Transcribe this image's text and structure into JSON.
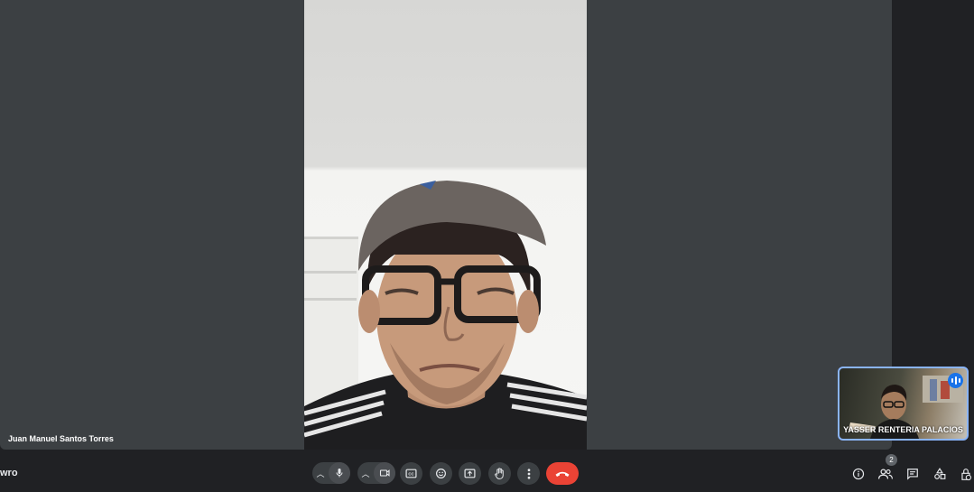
{
  "meeting": {
    "code_fragment": "wro"
  },
  "main_tile": {
    "participant_name": "Juan Manuel Santos Torres"
  },
  "self_view": {
    "participant_name": "YASSER RENTERIA PALACIOS"
  },
  "toolbar": {
    "participants_count": "2"
  },
  "icons": {
    "mic": "microphone-icon",
    "camera": "camera-icon",
    "captions": "closed-captions-icon",
    "reactions": "emoji-icon",
    "present": "present-screen-icon",
    "raise_hand": "raise-hand-icon",
    "more": "more-options-icon",
    "end": "end-call-icon",
    "info": "info-icon",
    "people": "people-icon",
    "chat": "chat-icon",
    "activities": "activities-icon",
    "host_controls": "host-controls-icon"
  },
  "colors": {
    "end_call": "#ea4335",
    "self_view_border": "#8ab4f8",
    "speaking_badge": "#1a73e8"
  }
}
